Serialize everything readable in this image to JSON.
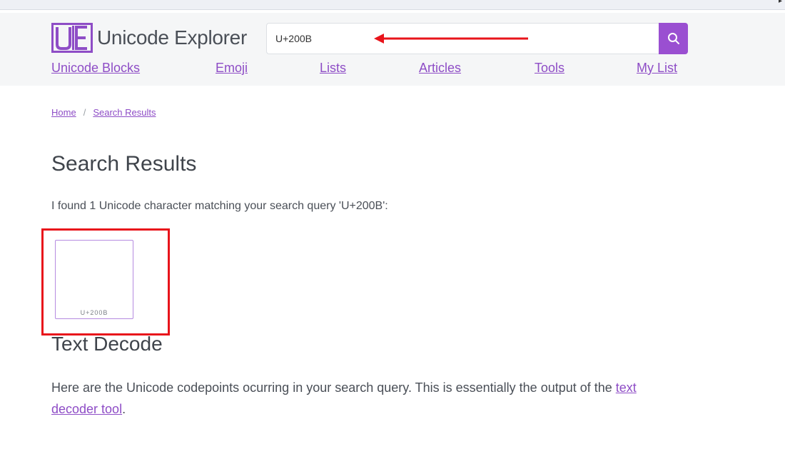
{
  "browser": {
    "corner_glyph": "▸"
  },
  "header": {
    "logo_text": "Unicode Explorer",
    "search_value": "U+200B"
  },
  "nav": [
    {
      "label": "Unicode Blocks"
    },
    {
      "label": "Emoji"
    },
    {
      "label": "Lists"
    },
    {
      "label": "Articles"
    },
    {
      "label": "Tools"
    },
    {
      "label": "My List"
    }
  ],
  "breadcrumb": {
    "home": "Home",
    "separator": "/",
    "current": "Search Results"
  },
  "main": {
    "title": "Search Results",
    "result_text": "I found 1 Unicode character matching your search query 'U+200B':",
    "results": [
      {
        "glyph": "​",
        "code": "U+200B"
      }
    ],
    "decode_title": "Text Decode",
    "decode_text_before": "Here are the Unicode codepoints ocurring in your search query. This is essentially the output of the ",
    "decode_link": "text decoder tool",
    "decode_text_after": "."
  },
  "colors": {
    "accent": "#8e4dc6",
    "annotation": "#e8141b",
    "header_bg": "#f5f6f7"
  },
  "icons": {
    "search": "search-icon",
    "logo": "ue-logo-icon"
  }
}
